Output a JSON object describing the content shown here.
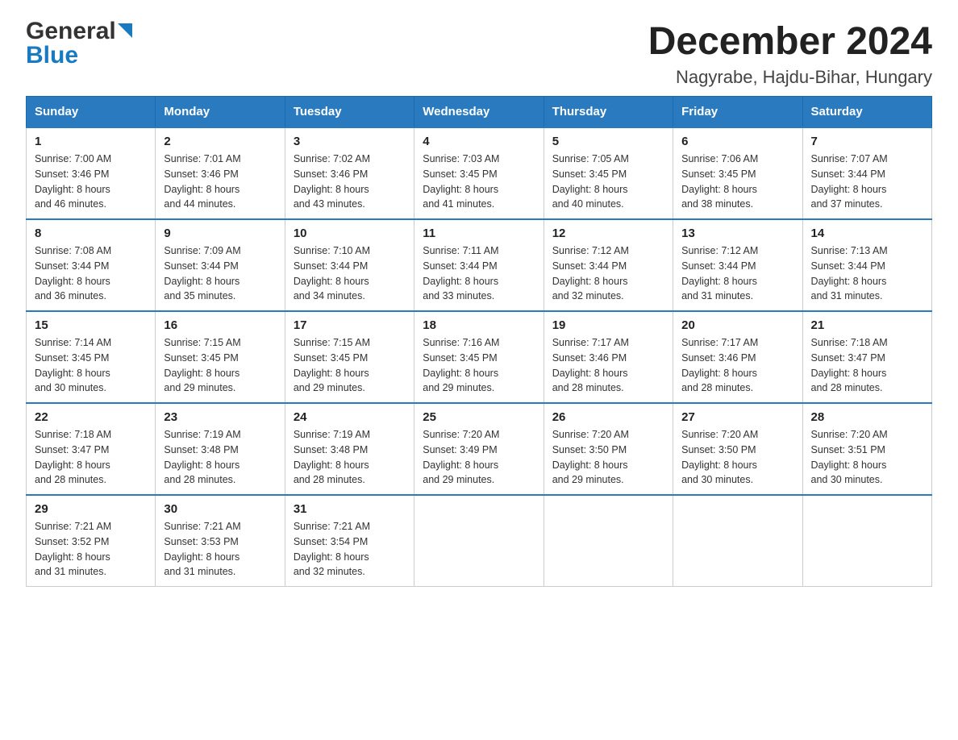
{
  "logo": {
    "general": "General",
    "blue": "Blue"
  },
  "title": "December 2024",
  "subtitle": "Nagyrabe, Hajdu-Bihar, Hungary",
  "calendar": {
    "headers": [
      "Sunday",
      "Monday",
      "Tuesday",
      "Wednesday",
      "Thursday",
      "Friday",
      "Saturday"
    ],
    "weeks": [
      [
        {
          "day": "1",
          "info": "Sunrise: 7:00 AM\nSunset: 3:46 PM\nDaylight: 8 hours\nand 46 minutes."
        },
        {
          "day": "2",
          "info": "Sunrise: 7:01 AM\nSunset: 3:46 PM\nDaylight: 8 hours\nand 44 minutes."
        },
        {
          "day": "3",
          "info": "Sunrise: 7:02 AM\nSunset: 3:46 PM\nDaylight: 8 hours\nand 43 minutes."
        },
        {
          "day": "4",
          "info": "Sunrise: 7:03 AM\nSunset: 3:45 PM\nDaylight: 8 hours\nand 41 minutes."
        },
        {
          "day": "5",
          "info": "Sunrise: 7:05 AM\nSunset: 3:45 PM\nDaylight: 8 hours\nand 40 minutes."
        },
        {
          "day": "6",
          "info": "Sunrise: 7:06 AM\nSunset: 3:45 PM\nDaylight: 8 hours\nand 38 minutes."
        },
        {
          "day": "7",
          "info": "Sunrise: 7:07 AM\nSunset: 3:44 PM\nDaylight: 8 hours\nand 37 minutes."
        }
      ],
      [
        {
          "day": "8",
          "info": "Sunrise: 7:08 AM\nSunset: 3:44 PM\nDaylight: 8 hours\nand 36 minutes."
        },
        {
          "day": "9",
          "info": "Sunrise: 7:09 AM\nSunset: 3:44 PM\nDaylight: 8 hours\nand 35 minutes."
        },
        {
          "day": "10",
          "info": "Sunrise: 7:10 AM\nSunset: 3:44 PM\nDaylight: 8 hours\nand 34 minutes."
        },
        {
          "day": "11",
          "info": "Sunrise: 7:11 AM\nSunset: 3:44 PM\nDaylight: 8 hours\nand 33 minutes."
        },
        {
          "day": "12",
          "info": "Sunrise: 7:12 AM\nSunset: 3:44 PM\nDaylight: 8 hours\nand 32 minutes."
        },
        {
          "day": "13",
          "info": "Sunrise: 7:12 AM\nSunset: 3:44 PM\nDaylight: 8 hours\nand 31 minutes."
        },
        {
          "day": "14",
          "info": "Sunrise: 7:13 AM\nSunset: 3:44 PM\nDaylight: 8 hours\nand 31 minutes."
        }
      ],
      [
        {
          "day": "15",
          "info": "Sunrise: 7:14 AM\nSunset: 3:45 PM\nDaylight: 8 hours\nand 30 minutes."
        },
        {
          "day": "16",
          "info": "Sunrise: 7:15 AM\nSunset: 3:45 PM\nDaylight: 8 hours\nand 29 minutes."
        },
        {
          "day": "17",
          "info": "Sunrise: 7:15 AM\nSunset: 3:45 PM\nDaylight: 8 hours\nand 29 minutes."
        },
        {
          "day": "18",
          "info": "Sunrise: 7:16 AM\nSunset: 3:45 PM\nDaylight: 8 hours\nand 29 minutes."
        },
        {
          "day": "19",
          "info": "Sunrise: 7:17 AM\nSunset: 3:46 PM\nDaylight: 8 hours\nand 28 minutes."
        },
        {
          "day": "20",
          "info": "Sunrise: 7:17 AM\nSunset: 3:46 PM\nDaylight: 8 hours\nand 28 minutes."
        },
        {
          "day": "21",
          "info": "Sunrise: 7:18 AM\nSunset: 3:47 PM\nDaylight: 8 hours\nand 28 minutes."
        }
      ],
      [
        {
          "day": "22",
          "info": "Sunrise: 7:18 AM\nSunset: 3:47 PM\nDaylight: 8 hours\nand 28 minutes."
        },
        {
          "day": "23",
          "info": "Sunrise: 7:19 AM\nSunset: 3:48 PM\nDaylight: 8 hours\nand 28 minutes."
        },
        {
          "day": "24",
          "info": "Sunrise: 7:19 AM\nSunset: 3:48 PM\nDaylight: 8 hours\nand 28 minutes."
        },
        {
          "day": "25",
          "info": "Sunrise: 7:20 AM\nSunset: 3:49 PM\nDaylight: 8 hours\nand 29 minutes."
        },
        {
          "day": "26",
          "info": "Sunrise: 7:20 AM\nSunset: 3:50 PM\nDaylight: 8 hours\nand 29 minutes."
        },
        {
          "day": "27",
          "info": "Sunrise: 7:20 AM\nSunset: 3:50 PM\nDaylight: 8 hours\nand 30 minutes."
        },
        {
          "day": "28",
          "info": "Sunrise: 7:20 AM\nSunset: 3:51 PM\nDaylight: 8 hours\nand 30 minutes."
        }
      ],
      [
        {
          "day": "29",
          "info": "Sunrise: 7:21 AM\nSunset: 3:52 PM\nDaylight: 8 hours\nand 31 minutes."
        },
        {
          "day": "30",
          "info": "Sunrise: 7:21 AM\nSunset: 3:53 PM\nDaylight: 8 hours\nand 31 minutes."
        },
        {
          "day": "31",
          "info": "Sunrise: 7:21 AM\nSunset: 3:54 PM\nDaylight: 8 hours\nand 32 minutes."
        },
        {
          "day": "",
          "info": ""
        },
        {
          "day": "",
          "info": ""
        },
        {
          "day": "",
          "info": ""
        },
        {
          "day": "",
          "info": ""
        }
      ]
    ]
  }
}
